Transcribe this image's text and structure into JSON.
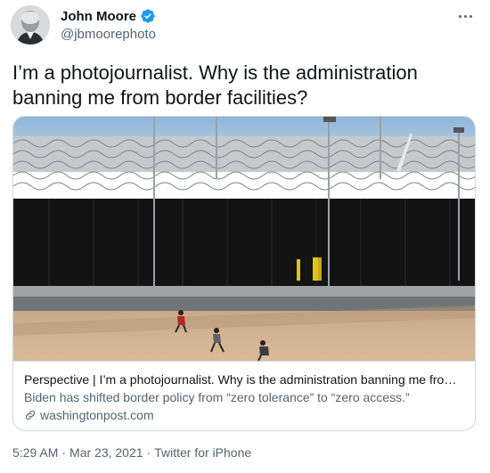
{
  "author": {
    "name": "John Moore",
    "handle": "@jbmoorephoto",
    "verified": true
  },
  "tweet": {
    "text": "I’m a photojournalist. Why is the administration banning me from border facilities?"
  },
  "card": {
    "title": "Perspective | I’m a photojournalist. Why is the administration banning me from …",
    "description": "Biden has shifted border policy from “zero tolerance” to “zero access.”",
    "domain": "washingtonpost.com"
  },
  "footer": {
    "time": "5:29 AM",
    "date": "Mar 23, 2021",
    "source": "Twitter for iPhone",
    "separator": "·"
  },
  "colors": {
    "text_primary": "#0f1419",
    "text_secondary": "#536471",
    "verified_blue": "#1d9bf0",
    "border": "#cfd9de"
  },
  "icons": [
    "verified-badge-icon",
    "more-options-icon",
    "link-icon"
  ]
}
